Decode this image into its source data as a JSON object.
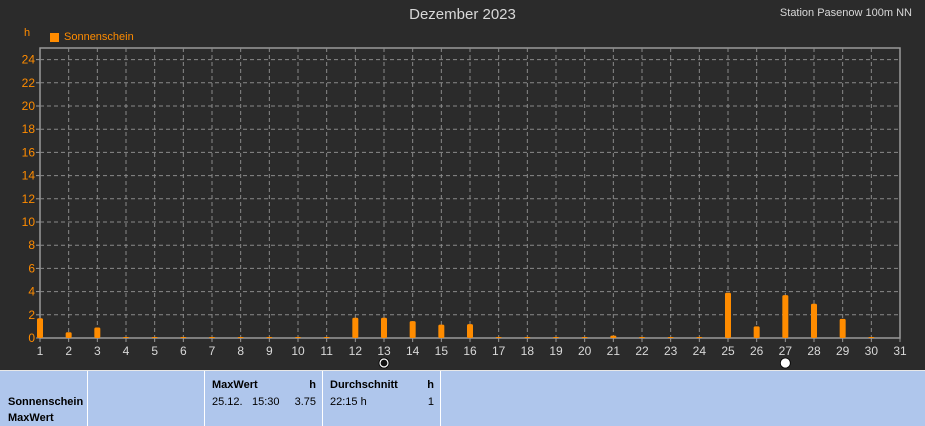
{
  "header": {
    "title": "Dezember 2023",
    "station": "Station Pasenow 100m NN",
    "unit": "h",
    "legend": "Sonnenschein"
  },
  "colors": {
    "background": "#2b2b2b",
    "grid": "#8a8a8a",
    "bar": "#ff8c00",
    "axis_text": "#ff8c00",
    "x_text": "#d8d8d8",
    "footer_bg": "#afc6ec"
  },
  "chart_data": {
    "type": "bar",
    "title": "Dezember 2023",
    "ylabel": "h",
    "xlabel": "",
    "ylim": [
      0,
      25
    ],
    "yticks": [
      0,
      2,
      4,
      6,
      8,
      10,
      12,
      14,
      16,
      18,
      20,
      22,
      24
    ],
    "x_ticks": [
      1,
      2,
      3,
      4,
      5,
      6,
      7,
      8,
      9,
      10,
      11,
      12,
      13,
      14,
      15,
      16,
      17,
      18,
      19,
      20,
      21,
      22,
      23,
      24,
      25,
      26,
      27,
      28,
      29,
      30,
      31
    ],
    "grid": true,
    "legend_position": "top-left",
    "series": [
      {
        "name": "Sonnenschein",
        "x": [
          1,
          2,
          3,
          4,
          5,
          6,
          7,
          8,
          9,
          10,
          11,
          12,
          13,
          14,
          15,
          16,
          17,
          18,
          19,
          20,
          21,
          22,
          23,
          24,
          25,
          26,
          27,
          28,
          29,
          30
        ],
        "values": [
          1.7,
          0.5,
          0.9,
          0.05,
          0.05,
          0.05,
          0.05,
          0.05,
          0.05,
          0.05,
          0.05,
          1.75,
          1.75,
          1.45,
          1.15,
          1.2,
          0.05,
          0.05,
          0.05,
          0.05,
          0.2,
          0.05,
          0.05,
          0.05,
          3.9,
          1.0,
          3.7,
          2.95,
          1.65,
          0.05
        ]
      }
    ],
    "moon_phases": [
      {
        "day": 13,
        "phase": "new-moon"
      },
      {
        "day": 27,
        "phase": "full-moon"
      }
    ]
  },
  "footer": {
    "row_label_1": "Sonnenschein",
    "row_label_2": "MaxWert",
    "max_header": "MaxWert",
    "max_unit": "h",
    "max_date": "25.12.",
    "max_time": "15:30",
    "max_value": "3.75",
    "avg_header": "Durchschnitt",
    "avg_unit": "h",
    "avg_time": "22:15 h",
    "avg_value": "1"
  }
}
